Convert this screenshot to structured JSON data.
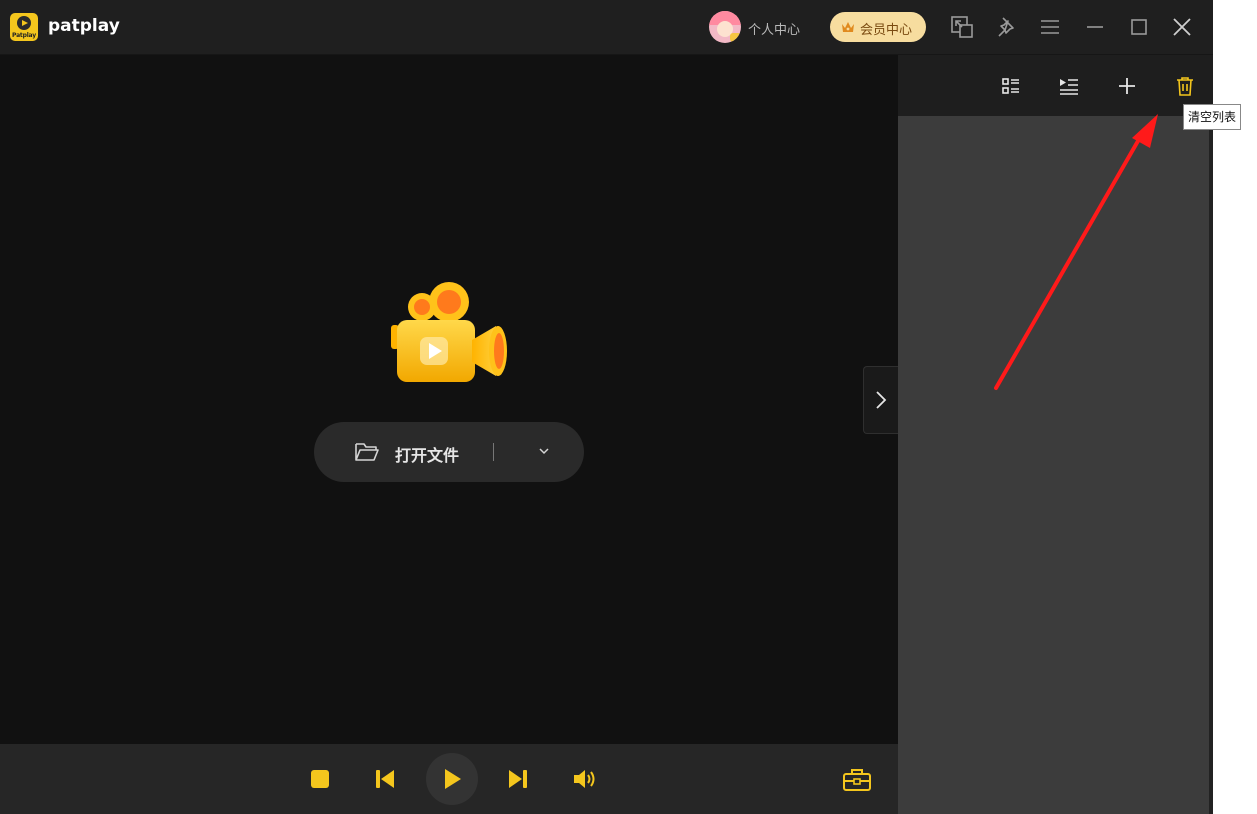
{
  "app": {
    "title": "patplay",
    "logo_text": "Patplay"
  },
  "titlebar": {
    "user_center_label": "个人中心",
    "vip_center_label": "会员中心",
    "icons": [
      "picture-in-picture-icon",
      "pin-icon",
      "menu-icon",
      "minimize-icon",
      "maximize-icon",
      "close-icon"
    ]
  },
  "player": {
    "open_file_label": "打开文件"
  },
  "controls": {
    "icons": [
      "stop-icon",
      "previous-icon",
      "play-icon",
      "next-icon",
      "volume-icon",
      "toolbox-icon"
    ]
  },
  "playlist": {
    "icons": [
      "list-view-icon",
      "play-list-icon",
      "add-icon",
      "trash-icon"
    ],
    "clear_tooltip": "清空列表"
  },
  "colors": {
    "accent": "#f4c61d",
    "background": "#111111",
    "panel": "#3c3c3c",
    "annotation_arrow": "#ff1a1a"
  }
}
